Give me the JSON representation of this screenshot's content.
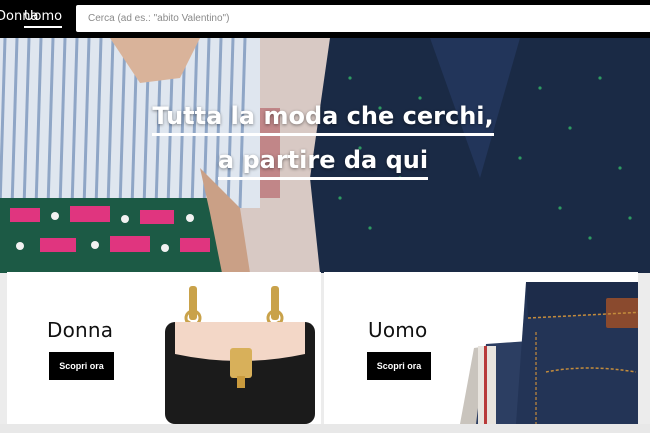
{
  "header": {
    "nav": [
      {
        "label": "Donna"
      },
      {
        "label": "Uomo"
      }
    ],
    "search": {
      "placeholder": "Cerca (ad es.: \"abito Valentino\")"
    }
  },
  "hero": {
    "headline_line1": "Tutta la moda che cerchi,",
    "headline_line2": "a partire da qui"
  },
  "categories": [
    {
      "title": "Donna",
      "button_label": "Scopri ora",
      "image_icon": "handbag-icon"
    },
    {
      "title": "Uomo",
      "button_label": "Scopri ora",
      "image_icon": "jeans-icon"
    }
  ],
  "colors": {
    "topbar": "#000000",
    "button": "#000000",
    "card_background": "#ffffff",
    "page_background": "#ececec"
  }
}
